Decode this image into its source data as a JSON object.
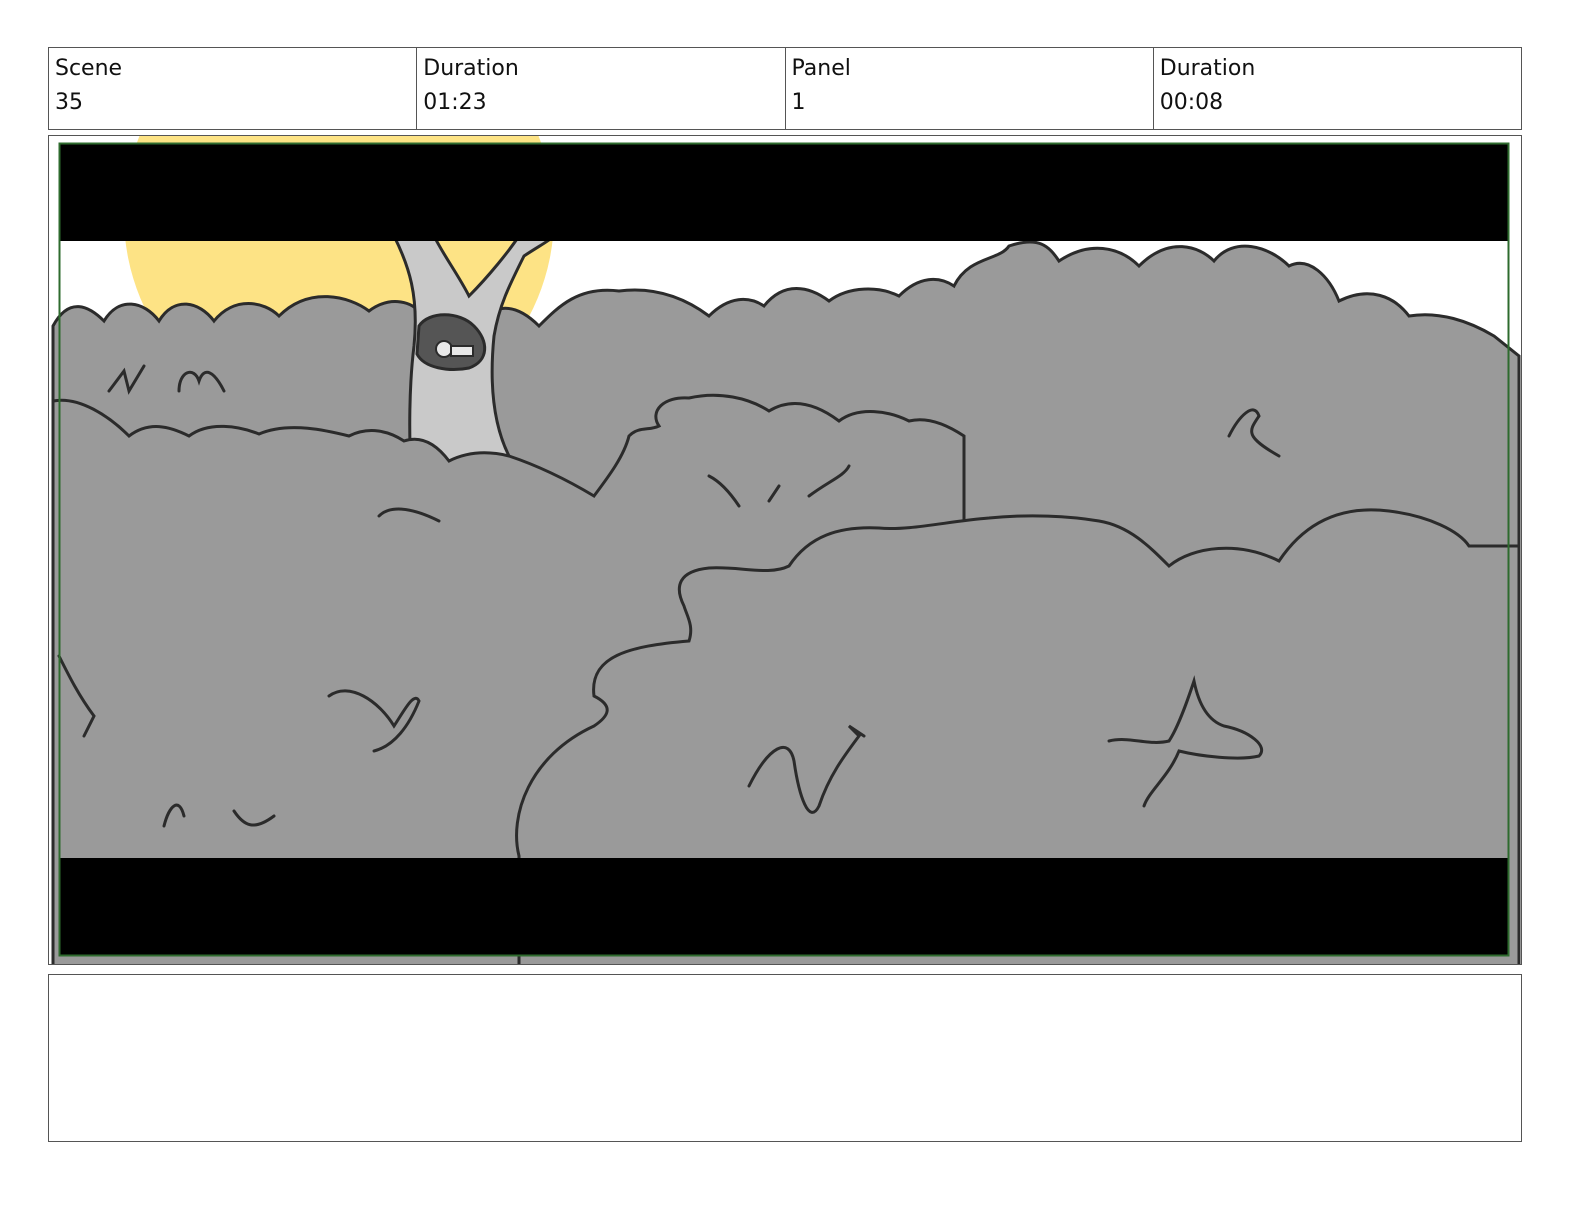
{
  "header": {
    "scene_label": "Scene",
    "scene_value": "35",
    "scene_duration_label": "Duration",
    "scene_duration_value": "01:23",
    "panel_label": "Panel",
    "panel_value": "1",
    "panel_duration_label": "Duration",
    "panel_duration_value": "00:08"
  },
  "panel": {
    "image_subject": "forest-bushes-tree-sketch",
    "colors": {
      "letterbox": "#000000",
      "sky": "#ffffff",
      "sun": "#fde385",
      "foliage": "#9a9a9a",
      "trunk": "#c9c9c9",
      "frame_border": "#2e6b2e",
      "ink": "#2b2b2b"
    }
  },
  "notes": {
    "text": ""
  }
}
